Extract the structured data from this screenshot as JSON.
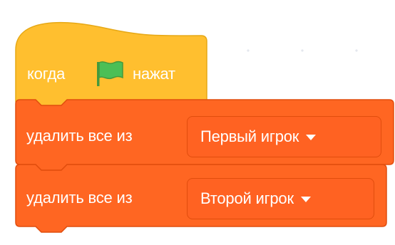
{
  "workspace": {
    "background": "#ffffff",
    "grid_dot_color": "#e4e7ee"
  },
  "script": {
    "hat_block": {
      "label_before": "когда",
      "icon": "green-flag-icon",
      "label_after": "нажат",
      "color": "#ffc735",
      "border_color": "#e6a815"
    },
    "blocks": [
      {
        "label": "удалить все из",
        "list_name": "Первый игрок",
        "color": "#ff6622",
        "border_color": "#e14d0d"
      },
      {
        "label": "удалить все из",
        "list_name": "Второй игрок",
        "color": "#ff6622",
        "border_color": "#e14d0d"
      }
    ]
  }
}
